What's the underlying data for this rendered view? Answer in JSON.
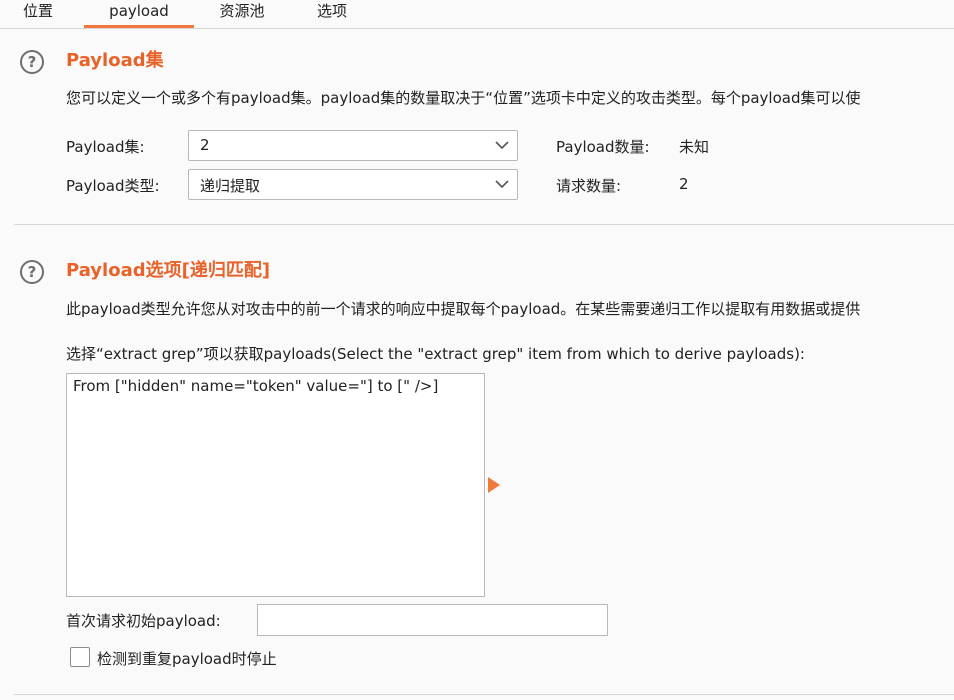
{
  "tabs": [
    {
      "label": "位置",
      "active": false
    },
    {
      "label": "payload",
      "active": true
    },
    {
      "label": "资源池",
      "active": false
    },
    {
      "label": "选项",
      "active": false
    }
  ],
  "payload_sets": {
    "title": "Payload集",
    "description": "您可以定义一个或多个有payload集。payload集的数量取决于“位置”选项卡中定义的攻击类型。每个payload集可以使",
    "set_label": "Payload集:",
    "set_value": "2",
    "type_label": "Payload类型:",
    "type_value": "递归提取",
    "count_label": "Payload数量:",
    "count_value": "未知",
    "requests_label": "请求数量:",
    "requests_value": "2"
  },
  "payload_options": {
    "title": "Payload选项[递归匹配]",
    "description": "此payload类型允许您从对攻击中的前一个请求的响应中提取每个payload。在某些需要递归工作以提取有用数据或提供",
    "grep_label": "选择“extract grep”项以获取payloads(Select the \"extract grep\" item from which to derive payloads):",
    "grep_items": [
      "From [\"hidden\" name=\"token\" value=\"] to [\" />]"
    ],
    "initial_payload_label": "首次请求初始payload:",
    "initial_payload_value": "",
    "stop_label": "检测到重复payload时停止",
    "stop_checked": false
  },
  "colors": {
    "accent": "#e8632a",
    "tab_underline": "#f0763a",
    "arrow": "#f07a3c"
  },
  "icons": [
    "help-icon",
    "chevron-down-icon",
    "play-arrow-icon"
  ]
}
